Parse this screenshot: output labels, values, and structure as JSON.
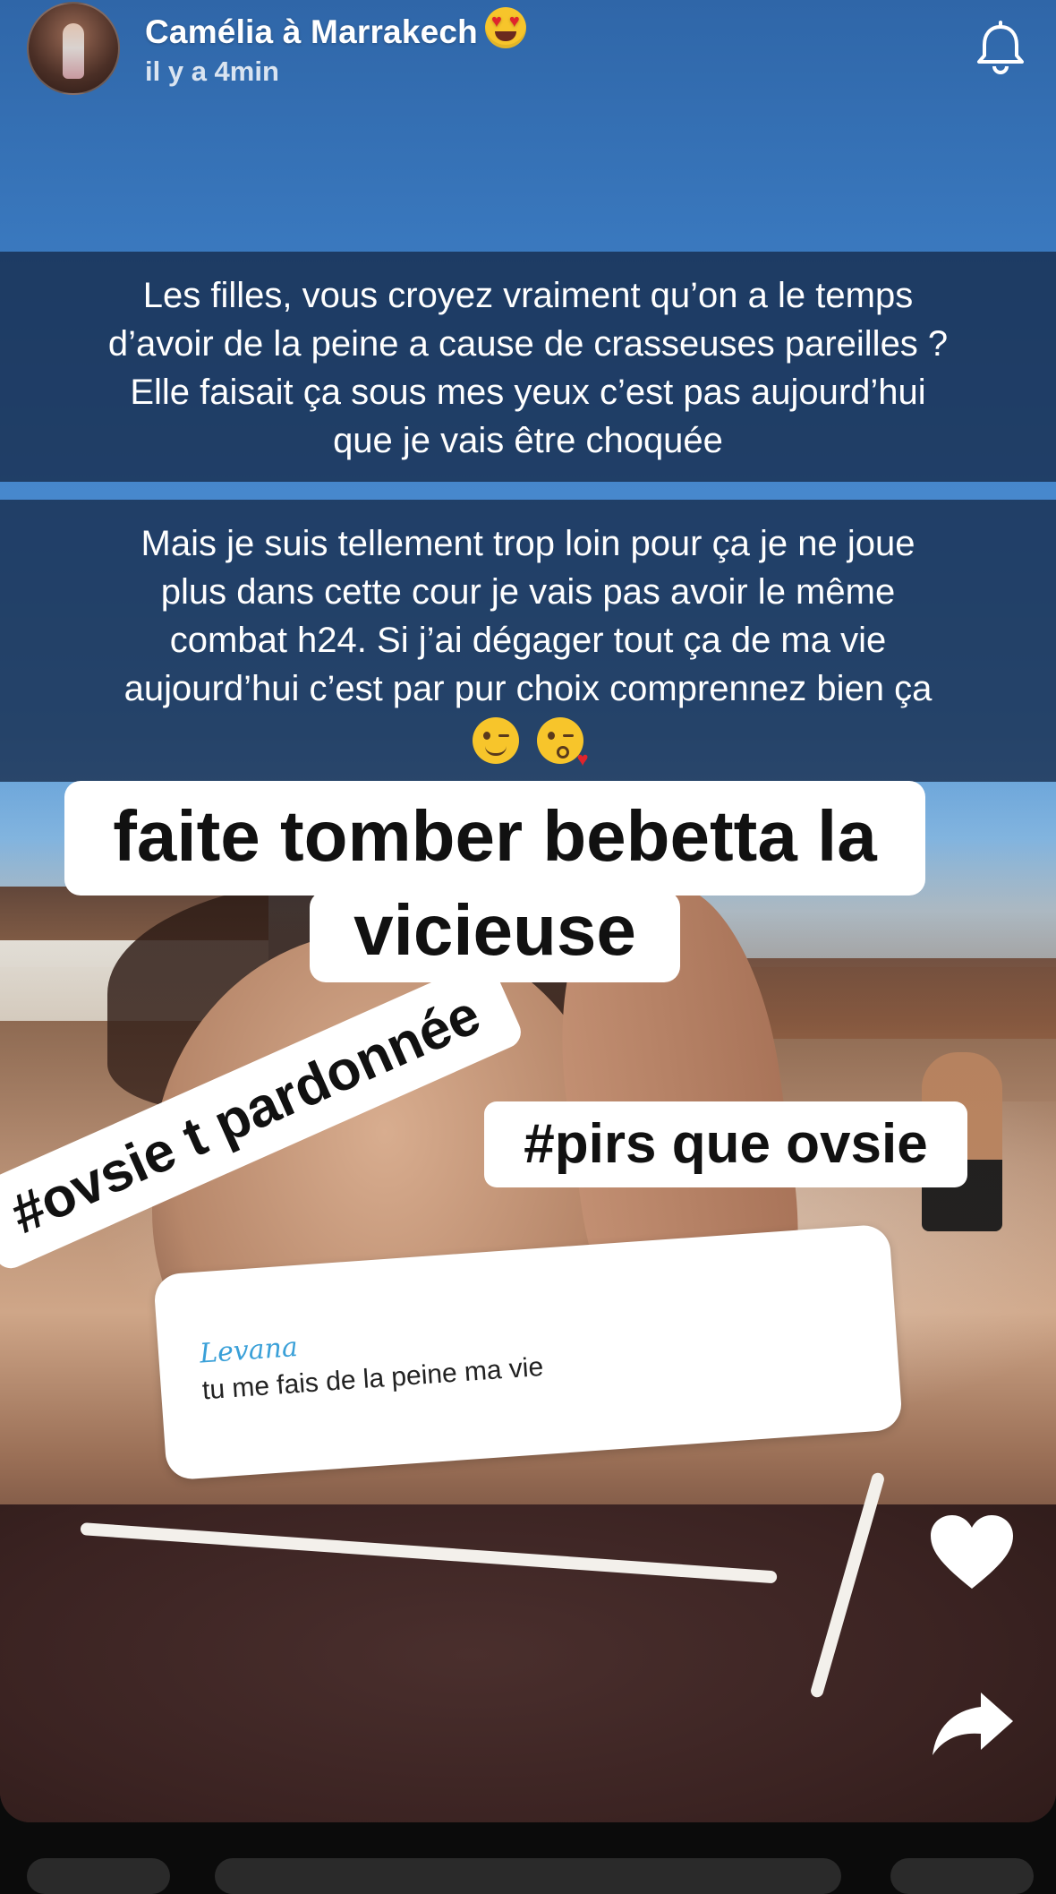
{
  "header": {
    "title": "Camélia à Marrakech",
    "title_emoji": "heart-eyes",
    "time": "il y a 4min"
  },
  "captions": {
    "first": [
      "Les filles, vous croyez vraiment qu’on a le temps",
      "d’avoir de la peine a cause de crasseuses pareilles ?",
      "Elle faisait ça sous mes yeux c’est pas aujourd’hui",
      "que je vais être choquée"
    ],
    "second": [
      "Mais je suis tellement trop loin pour ça je ne joue",
      "plus dans cette cour je vais pas avoir le même",
      "combat h24. Si j’ai dégager tout ça de ma vie",
      "aujourd’hui c’est par pur choix comprennez bien ça"
    ],
    "second_emojis": [
      "winking-face",
      "face-blowing-kiss"
    ]
  },
  "stickers": {
    "line1": "faite tomber bebetta la",
    "line2": "vicieuse",
    "tag1": "#ovsie t pardonnée",
    "tag2": "#pirs que ovsie"
  },
  "reply": {
    "name": "Levana",
    "message": "tu me fais de la peine ma vie"
  },
  "actions": {
    "like_icon": "heart-icon",
    "share_icon": "share-arrow-icon",
    "notify_icon": "bell-icon"
  },
  "colors": {
    "caption_bg": "#162a4a",
    "accent_heart": "#ffffff"
  }
}
